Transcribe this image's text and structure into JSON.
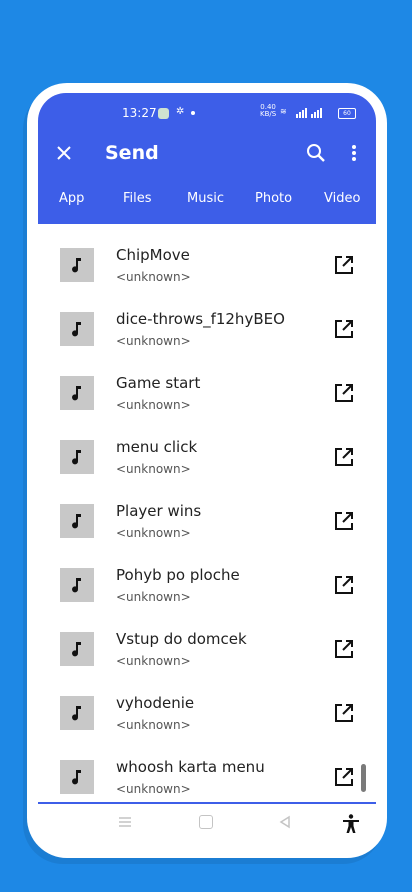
{
  "status": {
    "time": "13:27",
    "speed_value": "0.40",
    "speed_unit": "KB/S",
    "battery": "60"
  },
  "header": {
    "title": "Send"
  },
  "tabs": [
    {
      "label": "App"
    },
    {
      "label": "Files"
    },
    {
      "label": "Music"
    },
    {
      "label": "Photo"
    },
    {
      "label": "Video"
    }
  ],
  "items": [
    {
      "title": "ChipMove",
      "subtitle": "<unknown>"
    },
    {
      "title": "dice-throws_f12hyBEO",
      "subtitle": "<unknown>"
    },
    {
      "title": "Game start",
      "subtitle": "<unknown>"
    },
    {
      "title": "menu click",
      "subtitle": "<unknown>"
    },
    {
      "title": "Player wins",
      "subtitle": "<unknown>"
    },
    {
      "title": "Pohyb po ploche",
      "subtitle": "<unknown>"
    },
    {
      "title": "Vstup do domcek",
      "subtitle": "<unknown>"
    },
    {
      "title": "vyhodenie",
      "subtitle": "<unknown>"
    },
    {
      "title": "whoosh karta menu",
      "subtitle": "<unknown>"
    }
  ],
  "icons": {
    "close": "close-icon",
    "search": "search-icon",
    "more": "more-vertical-icon",
    "item_thumb": "music-note-icon",
    "item_action": "open-external-icon",
    "accessibility": "accessibility-icon"
  },
  "colors": {
    "background": "#1e88e5",
    "appbar": "#3d5ee8",
    "thumb": "#c8c8c8"
  }
}
